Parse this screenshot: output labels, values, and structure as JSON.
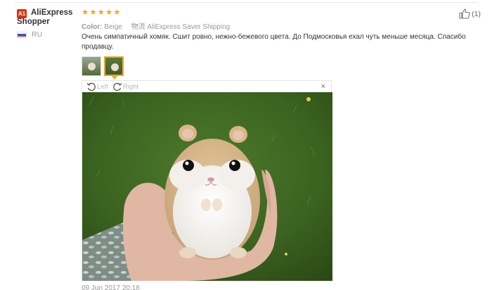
{
  "user": {
    "badge": "A1",
    "name_line1": "AliExpress",
    "name_line2": "Shopper",
    "country": "RU"
  },
  "review": {
    "stars": 5,
    "star_glyph": "★",
    "color_label": "Color:",
    "color_value": "Beige",
    "shipping_label": "物流",
    "shipping_value": "AliExpress Saver Shipping",
    "text": "Очень симпатичный хомяк. Сшит ровно, нежно-бежевого цвета. До Подмосковья ехал чуть меньше месяца. Спасибо продавцу.",
    "date": "09 Jun 2017 20:18"
  },
  "helpful": {
    "count": "(1)",
    "icon": "thumbs-up-icon"
  },
  "viewer": {
    "rotate_left": "Left",
    "rotate_right": "Right",
    "close": "×"
  },
  "colors": {
    "star": "#f5a623",
    "badge": "#e62e04",
    "active_thumb_border": "#f5a623"
  }
}
